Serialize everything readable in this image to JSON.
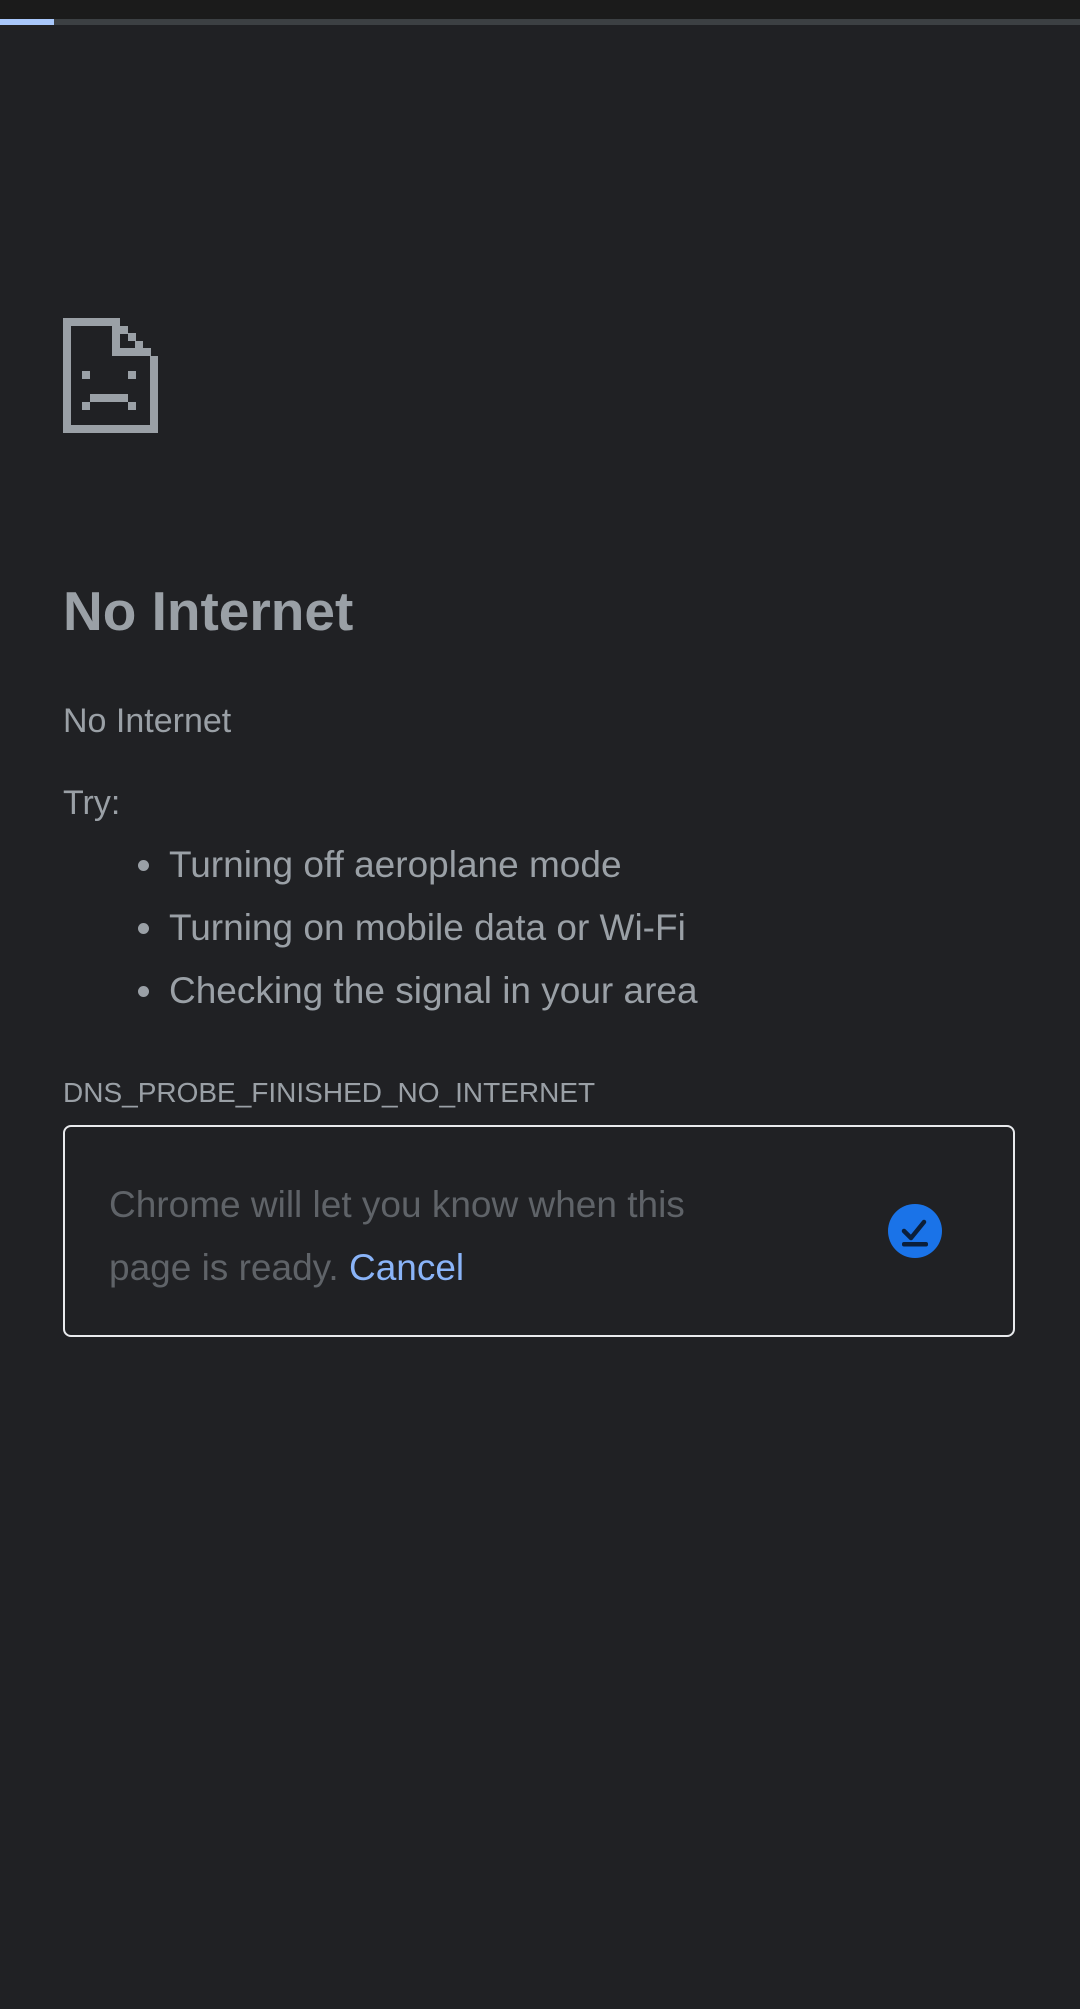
{
  "progress": {
    "fraction": 0.05,
    "track_color": "#3c4043",
    "fill_color": "#a8c7fa"
  },
  "error_page": {
    "icon": "sad-page-icon",
    "title": "No Internet",
    "subtitle": "No Internet",
    "try_label": "Try:",
    "suggestions": [
      "Turning off aeroplane mode",
      "Turning on mobile data or Wi-Fi",
      "Checking the signal in your area"
    ],
    "error_code": "DNS_PROBE_FINISHED_NO_INTERNET"
  },
  "notify": {
    "message": "Chrome will let you know when this page is ready.",
    "cancel_label": "Cancel",
    "icon": "download-check-icon",
    "icon_color": "#1a73e8"
  },
  "colors": {
    "background": "#202124",
    "text": "#9aa0a6",
    "muted_text": "#5f6368",
    "link": "#8ab4f8"
  }
}
